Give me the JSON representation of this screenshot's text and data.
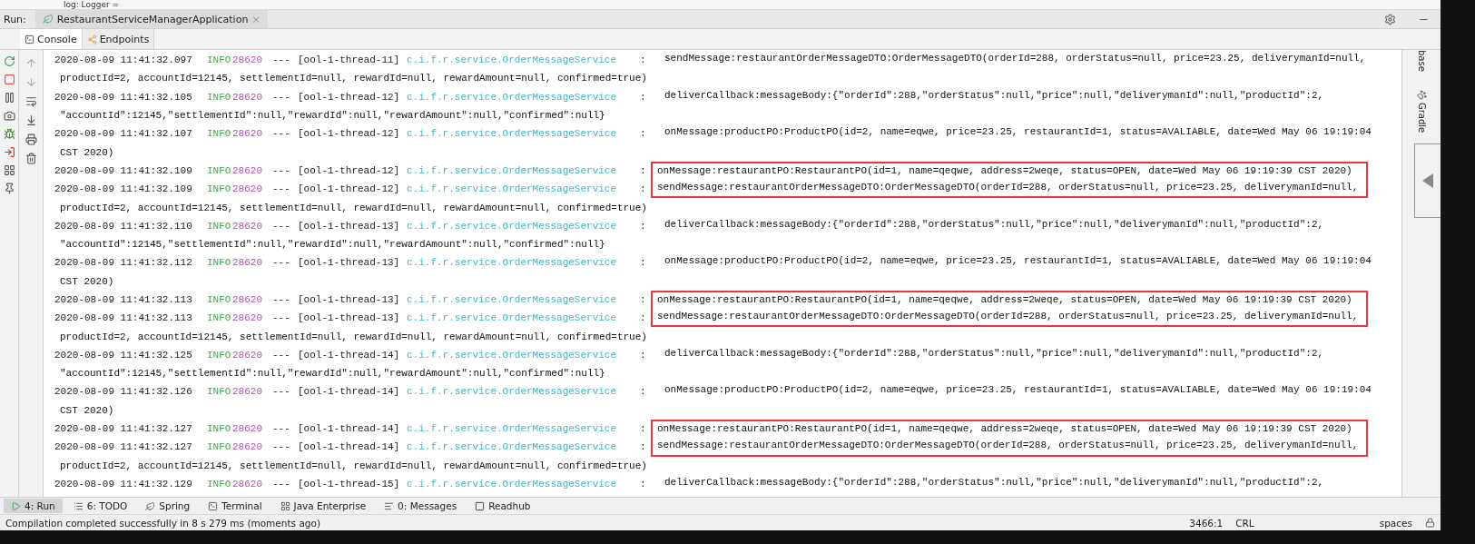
{
  "editor_strip": {
    "text": "log: Logger ="
  },
  "run_bar": {
    "label": "Run:",
    "config_tab": {
      "title": "RestaurantServiceManagerApplication",
      "close": "×",
      "selected": true
    }
  },
  "tabs": [
    {
      "label": "Console",
      "selected": true
    },
    {
      "label": "Endpoints",
      "selected": false
    }
  ],
  "console": {
    "lines": [
      {
        "kind": "entry",
        "timestamp": "2020-08-09 11:41:32.097",
        "level": "INFO",
        "pid": "28620",
        "dashes": "---",
        "thread": "[ool-1-thread-11]",
        "logger": "c.i.f.r.service.OrderMessageService",
        "sep": ":",
        "message": "sendMessage:restaurantOrderMessageDTO:OrderMessageDTO(orderId=288, orderStatus=null, price=23.25, deliverymanId=null,",
        "highlighted": false
      },
      {
        "kind": "continuation",
        "text": "productId=2, accountId=12145, settlementId=null, rewardId=null, rewardAmount=null, confirmed=true)"
      },
      {
        "kind": "entry",
        "timestamp": "2020-08-09 11:41:32.105",
        "level": "INFO",
        "pid": "28620",
        "dashes": "---",
        "thread": "[ool-1-thread-12]",
        "logger": "c.i.f.r.service.OrderMessageService",
        "sep": ":",
        "message": "deliverCallback:messageBody:{\"orderId\":288,\"orderStatus\":null,\"price\":null,\"deliverymanId\":null,\"productId\":2,",
        "highlighted": false
      },
      {
        "kind": "continuation",
        "text": "\"accountId\":12145,\"settlementId\":null,\"rewardId\":null,\"rewardAmount\":null,\"confirmed\":null}"
      },
      {
        "kind": "entry",
        "timestamp": "2020-08-09 11:41:32.107",
        "level": "INFO",
        "pid": "28620",
        "dashes": "---",
        "thread": "[ool-1-thread-12]",
        "logger": "c.i.f.r.service.OrderMessageService",
        "sep": ":",
        "message": "onMessage:productPO:ProductPO(id=2, name=eqwe, price=23.25, restaurantId=1, status=AVALIABLE, date=Wed May 06 19:19:04",
        "highlighted": false
      },
      {
        "kind": "continuation",
        "text": "CST 2020)"
      },
      {
        "kind": "entry",
        "timestamp": "2020-08-09 11:41:32.109",
        "level": "INFO",
        "pid": "28620",
        "dashes": "---",
        "thread": "[ool-1-thread-12]",
        "logger": "c.i.f.r.service.OrderMessageService",
        "sep": ":",
        "message": "onMessage:restaurantPO:RestaurantPO(id=1, name=qeqwe, address=2weqe, status=OPEN, date=Wed May 06 19:19:39 CST 2020)",
        "highlighted": true
      },
      {
        "kind": "entry",
        "timestamp": "2020-08-09 11:41:32.109",
        "level": "INFO",
        "pid": "28620",
        "dashes": "---",
        "thread": "[ool-1-thread-12]",
        "logger": "c.i.f.r.service.OrderMessageService",
        "sep": ":",
        "message": "sendMessage:restaurantOrderMessageDTO:OrderMessageDTO(orderId=288, orderStatus=null, price=23.25, deliverymanId=null,",
        "highlighted": true
      },
      {
        "kind": "continuation",
        "text": "productId=2, accountId=12145, settlementId=null, rewardId=null, rewardAmount=null, confirmed=true)"
      },
      {
        "kind": "entry",
        "timestamp": "2020-08-09 11:41:32.110",
        "level": "INFO",
        "pid": "28620",
        "dashes": "---",
        "thread": "[ool-1-thread-13]",
        "logger": "c.i.f.r.service.OrderMessageService",
        "sep": ":",
        "message": "deliverCallback:messageBody:{\"orderId\":288,\"orderStatus\":null,\"price\":null,\"deliverymanId\":null,\"productId\":2,",
        "highlighted": false
      },
      {
        "kind": "continuation",
        "text": "\"accountId\":12145,\"settlementId\":null,\"rewardId\":null,\"rewardAmount\":null,\"confirmed\":null}"
      },
      {
        "kind": "entry",
        "timestamp": "2020-08-09 11:41:32.112",
        "level": "INFO",
        "pid": "28620",
        "dashes": "---",
        "thread": "[ool-1-thread-13]",
        "logger": "c.i.f.r.service.OrderMessageService",
        "sep": ":",
        "message": "onMessage:productPO:ProductPO(id=2, name=eqwe, price=23.25, restaurantId=1, status=AVALIABLE, date=Wed May 06 19:19:04",
        "highlighted": false
      },
      {
        "kind": "continuation",
        "text": "CST 2020)"
      },
      {
        "kind": "entry",
        "timestamp": "2020-08-09 11:41:32.113",
        "level": "INFO",
        "pid": "28620",
        "dashes": "---",
        "thread": "[ool-1-thread-13]",
        "logger": "c.i.f.r.service.OrderMessageService",
        "sep": ":",
        "message": "onMessage:restaurantPO:RestaurantPO(id=1, name=qeqwe, address=2weqe, status=OPEN, date=Wed May 06 19:19:39 CST 2020)",
        "highlighted": true
      },
      {
        "kind": "entry",
        "timestamp": "2020-08-09 11:41:32.113",
        "level": "INFO",
        "pid": "28620",
        "dashes": "---",
        "thread": "[ool-1-thread-13]",
        "logger": "c.i.f.r.service.OrderMessageService",
        "sep": ":",
        "message": "sendMessage:restaurantOrderMessageDTO:OrderMessageDTO(orderId=288, orderStatus=null, price=23.25, deliverymanId=null,",
        "highlighted": true
      },
      {
        "kind": "continuation",
        "text": "productId=2, accountId=12145, settlementId=null, rewardId=null, rewardAmount=null, confirmed=true)"
      },
      {
        "kind": "entry",
        "timestamp": "2020-08-09 11:41:32.125",
        "level": "INFO",
        "pid": "28620",
        "dashes": "---",
        "thread": "[ool-1-thread-14]",
        "logger": "c.i.f.r.service.OrderMessageService",
        "sep": ":",
        "message": "deliverCallback:messageBody:{\"orderId\":288,\"orderStatus\":null,\"price\":null,\"deliverymanId\":null,\"productId\":2,",
        "highlighted": false
      },
      {
        "kind": "continuation",
        "text": "\"accountId\":12145,\"settlementId\":null,\"rewardId\":null,\"rewardAmount\":null,\"confirmed\":null}"
      },
      {
        "kind": "entry",
        "timestamp": "2020-08-09 11:41:32.126",
        "level": "INFO",
        "pid": "28620",
        "dashes": "---",
        "thread": "[ool-1-thread-14]",
        "logger": "c.i.f.r.service.OrderMessageService",
        "sep": ":",
        "message": "onMessage:productPO:ProductPO(id=2, name=eqwe, price=23.25, restaurantId=1, status=AVALIABLE, date=Wed May 06 19:19:04",
        "highlighted": false
      },
      {
        "kind": "continuation",
        "text": "CST 2020)"
      },
      {
        "kind": "entry",
        "timestamp": "2020-08-09 11:41:32.127",
        "level": "INFO",
        "pid": "28620",
        "dashes": "---",
        "thread": "[ool-1-thread-14]",
        "logger": "c.i.f.r.service.OrderMessageService",
        "sep": ":",
        "message": "onMessage:restaurantPO:RestaurantPO(id=1, name=qeqwe, address=2weqe, status=OPEN, date=Wed May 06 19:19:39 CST 2020)",
        "highlighted": true
      },
      {
        "kind": "entry",
        "timestamp": "2020-08-09 11:41:32.127",
        "level": "INFO",
        "pid": "28620",
        "dashes": "---",
        "thread": "[ool-1-thread-14]",
        "logger": "c.i.f.r.service.OrderMessageService",
        "sep": ":",
        "message": "sendMessage:restaurantOrderMessageDTO:OrderMessageDTO(orderId=288, orderStatus=null, price=23.25, deliverymanId=null,",
        "highlighted": true
      },
      {
        "kind": "continuation",
        "text": "productId=2, accountId=12145, settlementId=null, rewardId=null, rewardAmount=null, confirmed=true)"
      },
      {
        "kind": "entry",
        "timestamp": "2020-08-09 11:41:32.129",
        "level": "INFO",
        "pid": "28620",
        "dashes": "---",
        "thread": "[ool-1-thread-15]",
        "logger": "c.i.f.r.service.OrderMessageService",
        "sep": ":",
        "message": "deliverCallback:messageBody:{\"orderId\":288,\"orderStatus\":null,\"price\":null,\"deliverymanId\":null,\"productId\":2,",
        "highlighted": false
      }
    ]
  },
  "right_strip": {
    "items": [
      "base",
      "Gradle"
    ]
  },
  "tool_windows": [
    {
      "label": "4: Run",
      "selected": true
    },
    {
      "label": "6: TODO",
      "selected": false
    },
    {
      "label": "Spring",
      "selected": false
    },
    {
      "label": "Terminal",
      "selected": false
    },
    {
      "label": "Java Enterprise",
      "selected": false
    },
    {
      "label": "0: Messages",
      "selected": false
    },
    {
      "label": "Readhub",
      "selected": false
    }
  ],
  "status_bar": {
    "message": "Compilation completed successfully in 8 s 279 ms (moments ago)",
    "position": "3466:1",
    "line_separator": "CRL",
    "indent": "spaces"
  }
}
